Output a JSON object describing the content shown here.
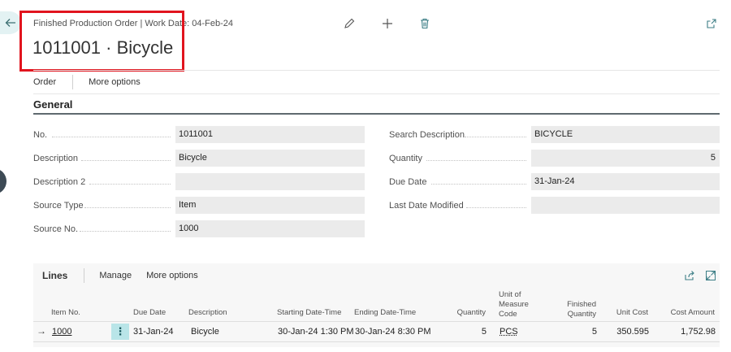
{
  "header": {
    "breadcrumb": "Finished Production Order | Work Date: 04-Feb-24",
    "title": "1011001 · Bicycle"
  },
  "actions": {
    "order": "Order",
    "more_options": "More options"
  },
  "general": {
    "section_title": "General",
    "left_fields": [
      {
        "label": "No.",
        "value": "1011001"
      },
      {
        "label": "Description",
        "value": "Bicycle"
      },
      {
        "label": "Description 2",
        "value": ""
      },
      {
        "label": "Source Type",
        "value": "Item"
      },
      {
        "label": "Source No.",
        "value": "1000"
      }
    ],
    "right_fields": [
      {
        "label": "Search Description",
        "value": "BICYCLE"
      },
      {
        "label": "Quantity",
        "value": "5"
      },
      {
        "label": "Due Date",
        "value": "31-Jan-24"
      },
      {
        "label": "Last Date Modified",
        "value": ""
      }
    ]
  },
  "lines": {
    "title": "Lines",
    "manage": "Manage",
    "more_options": "More options",
    "columns": {
      "item_no": "Item No.",
      "due_date": "Due Date",
      "description": "Description",
      "starting": "Starting Date-Time",
      "ending": "Ending Date-Time",
      "quantity": "Quantity",
      "uom_1": "Unit of",
      "uom_2": "Measure",
      "uom_3": "Code",
      "finished_1": "Finished",
      "finished_2": "Quantity",
      "unit_cost": "Unit Cost",
      "cost_amount": "Cost Amount"
    },
    "row": {
      "arrow": "→",
      "menu": "⋮",
      "item_no": "1000",
      "due_date": "31-Jan-24",
      "description": "Bicycle",
      "starting": "30-Jan-24 1:30 PM",
      "ending": "30-Jan-24 8:30 PM",
      "quantity": "5",
      "uom": "PCS",
      "finished": "5",
      "unit_cost": "350.595",
      "cost_amount": "1,752.98"
    }
  },
  "icons": {
    "back": "back-arrow-icon",
    "edit": "pencil-icon",
    "new": "plus-icon",
    "delete": "trash-icon",
    "open_new_window": "open-in-new-icon",
    "share": "share-icon",
    "expand": "expand-icon"
  },
  "colors": {
    "highlight": "#e1141e",
    "accent": "#3c7e86",
    "field_bg": "#ebebeb"
  }
}
